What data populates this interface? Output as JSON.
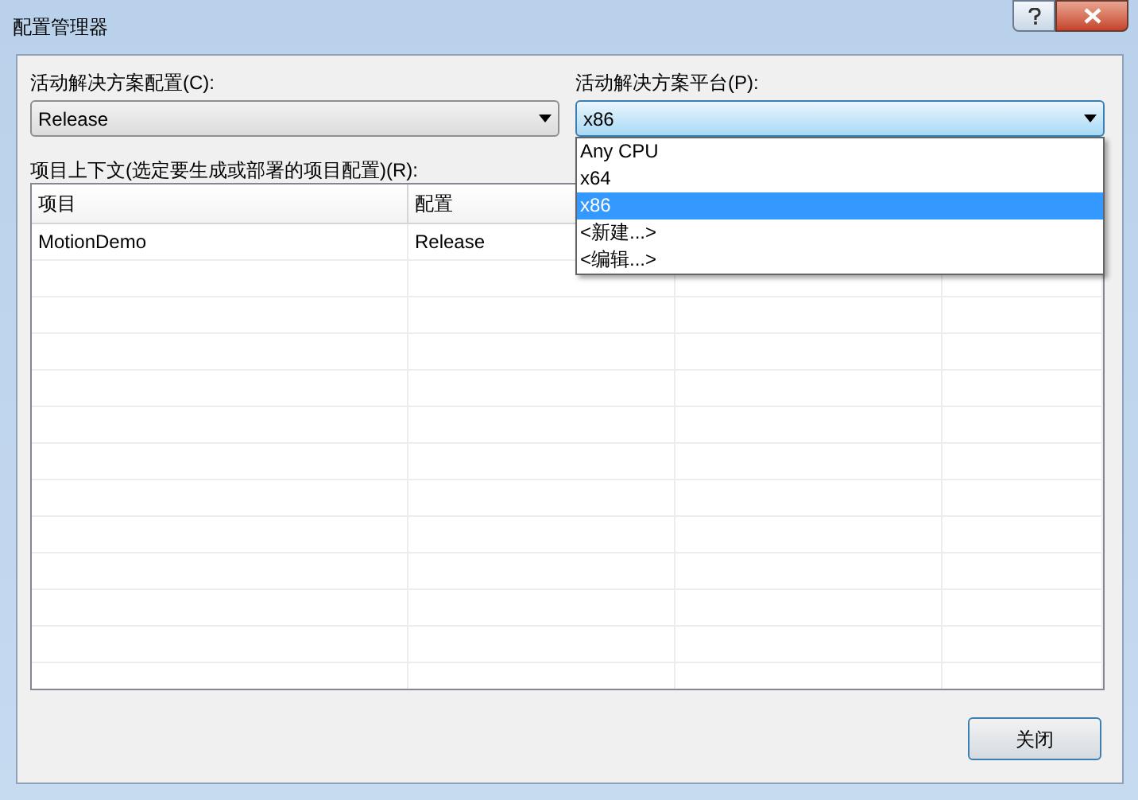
{
  "window": {
    "title": "配置管理器"
  },
  "config": {
    "label": "活动解决方案配置(C):",
    "value": "Release"
  },
  "platform": {
    "label": "活动解决方案平台(P):",
    "value": "x86",
    "expanded": true,
    "options": [
      {
        "label": "Any CPU",
        "selected": false
      },
      {
        "label": "x64",
        "selected": false
      },
      {
        "label": "x86",
        "selected": true
      },
      {
        "label": "<新建...>",
        "selected": false
      },
      {
        "label": "<编辑...>",
        "selected": false
      }
    ]
  },
  "project_context": {
    "label": "项目上下文(选定要生成或部署的项目配置)(R):",
    "columns": [
      "项目",
      "配置"
    ],
    "rows": [
      [
        "MotionDemo",
        "Release"
      ]
    ]
  },
  "buttons": [
    "关闭"
  ]
}
